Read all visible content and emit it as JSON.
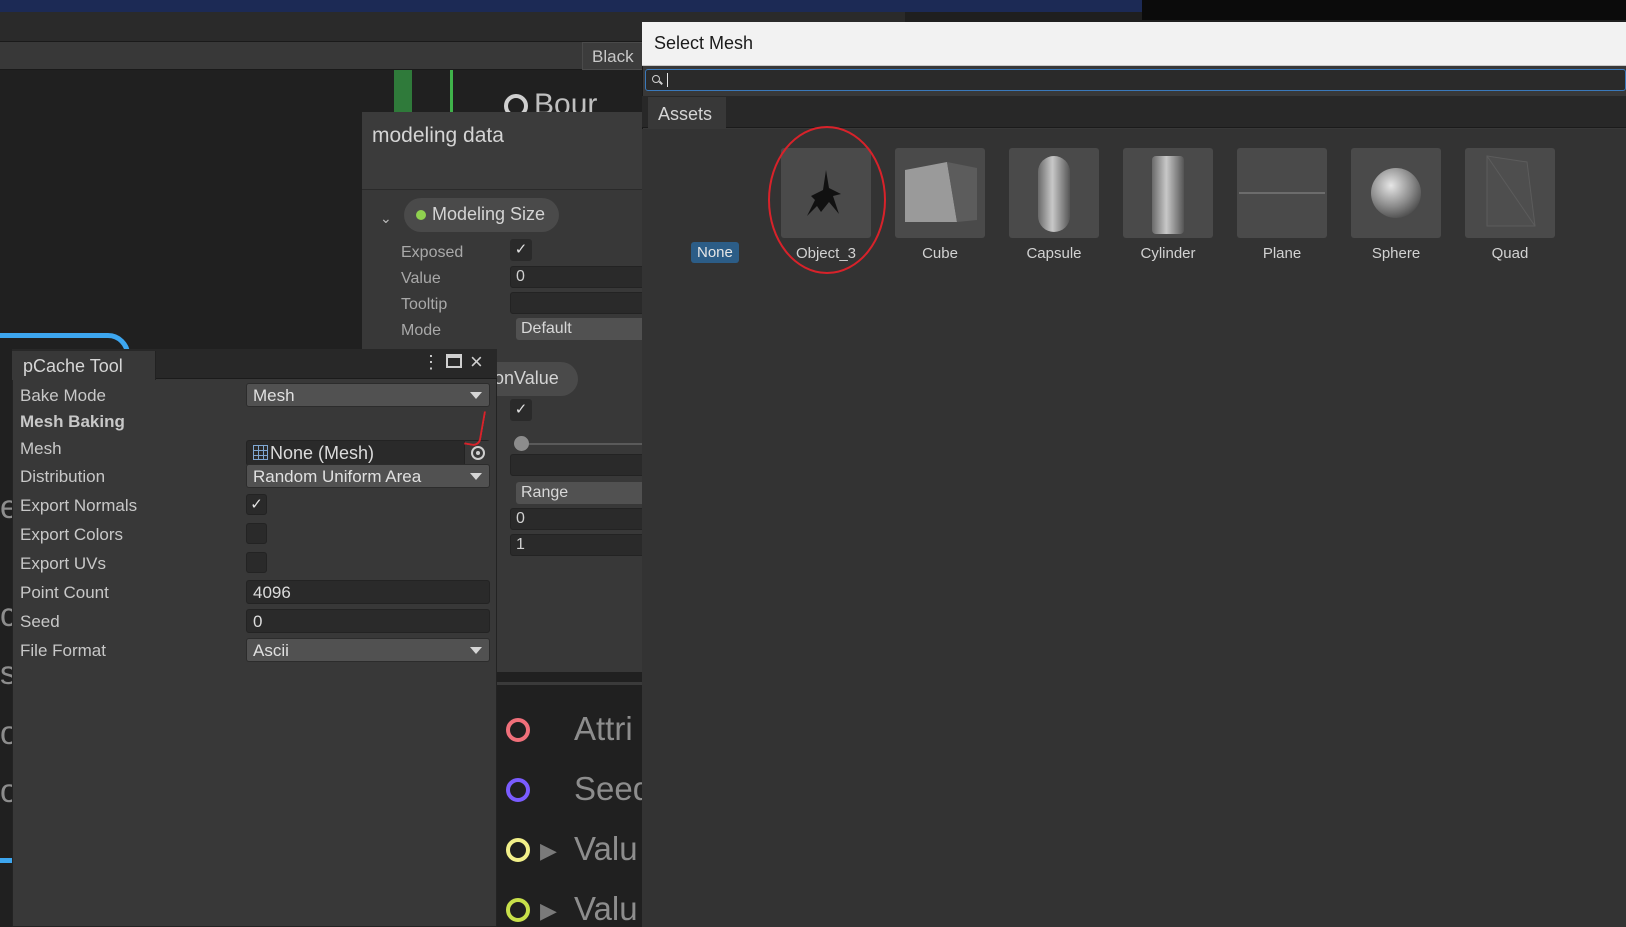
{
  "background": {
    "blackboard_tab": "Black",
    "bound_label": "Bour",
    "blackboard": {
      "section_title": "modeling data",
      "property_name": "Modeling Size",
      "rows": [
        {
          "label": "Exposed"
        },
        {
          "label": "Value",
          "value": "0"
        },
        {
          "label": "Tooltip",
          "value": ""
        },
        {
          "label": "Mode",
          "value": "Default"
        }
      ],
      "second_property": "onValue",
      "second_rows": {
        "mode": "Range",
        "min": "0",
        "max": "1"
      }
    },
    "ports": [
      {
        "label": "Attri",
        "color": "#f0707a"
      },
      {
        "label": "Seed",
        "color": "#7a5cff"
      },
      {
        "label": "Valu",
        "color": "#f2f08a"
      },
      {
        "label": "Valu",
        "color": "#c8e04a"
      }
    ],
    "left_letters": [
      "e",
      "c",
      "s",
      "o",
      "o"
    ]
  },
  "pcache": {
    "tab": "pCache Tool",
    "icons": [
      "more-vertical-icon",
      "maximize-icon",
      "close-icon"
    ],
    "bake_mode": {
      "label": "Bake Mode",
      "value": "Mesh"
    },
    "section": "Mesh Baking",
    "mesh": {
      "label": "Mesh",
      "value": "None (Mesh)"
    },
    "distribution": {
      "label": "Distribution",
      "value": "Random Uniform Area"
    },
    "export_normals": {
      "label": "Export Normals",
      "checked": true
    },
    "export_colors": {
      "label": "Export Colors",
      "checked": false
    },
    "export_uvs": {
      "label": "Export UVs",
      "checked": false
    },
    "point_count": {
      "label": "Point Count",
      "value": "4096"
    },
    "seed": {
      "label": "Seed",
      "value": "0"
    },
    "file_format": {
      "label": "File Format",
      "value": "Ascii"
    }
  },
  "select_mesh": {
    "title": "Select Mesh",
    "search": {
      "value": "",
      "placeholder": ""
    },
    "tab": "Assets",
    "none_label": "None",
    "assets": [
      {
        "name": "Object_3",
        "icon": "bird-silhouette-icon"
      },
      {
        "name": "Cube",
        "icon": "cube-icon"
      },
      {
        "name": "Capsule",
        "icon": "capsule-icon"
      },
      {
        "name": "Cylinder",
        "icon": "cylinder-icon"
      },
      {
        "name": "Plane",
        "icon": "plane-icon"
      },
      {
        "name": "Sphere",
        "icon": "sphere-icon"
      },
      {
        "name": "Quad",
        "icon": "quad-icon"
      }
    ],
    "annotation_color": "#d8222a"
  }
}
